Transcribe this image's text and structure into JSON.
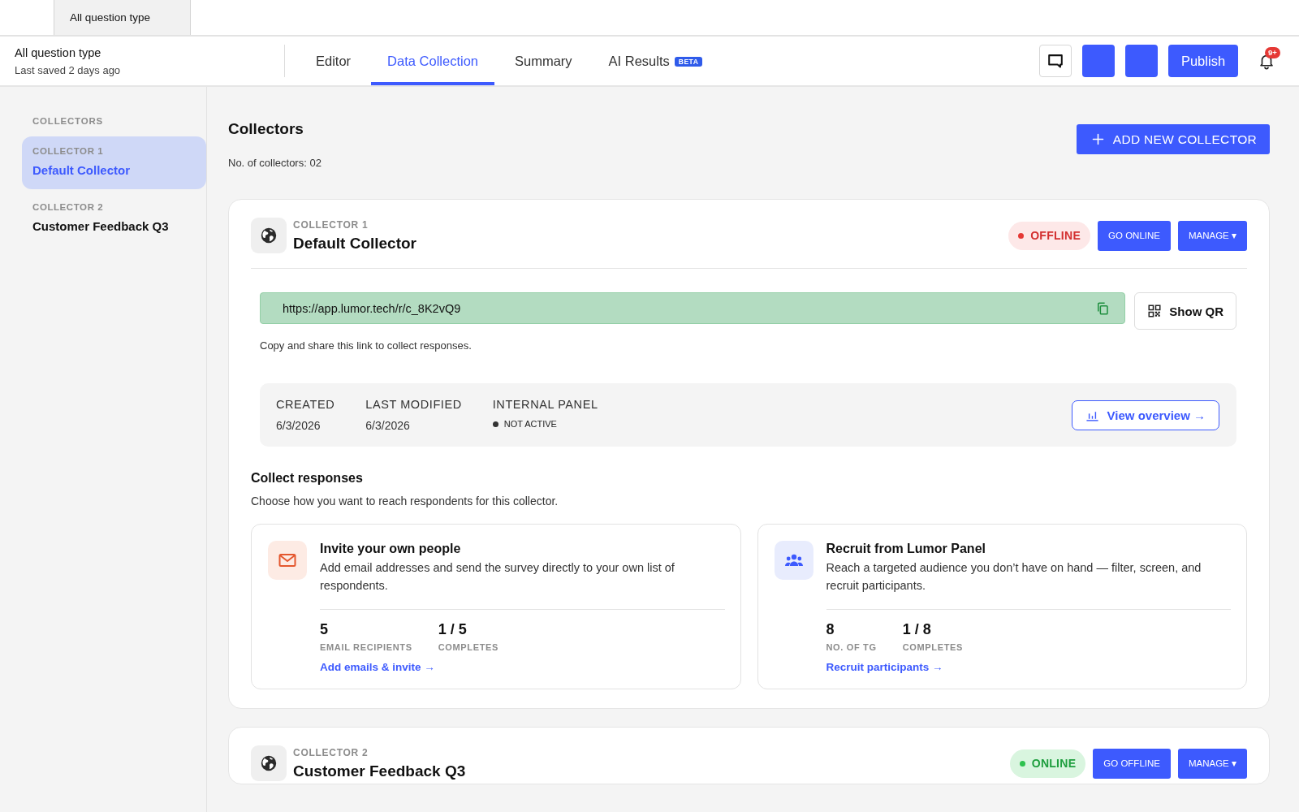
{
  "document_tab": {
    "label": "All question type"
  },
  "header": {
    "survey_title": "All question type",
    "saved_status": "Last saved 2 days ago",
    "tabs": [
      {
        "label": "Editor",
        "selected": false
      },
      {
        "label": "Data Collection",
        "selected": true
      },
      {
        "label": "Summary",
        "selected": false
      },
      {
        "label": "AI Results",
        "selected": false,
        "badge": "BETA"
      }
    ],
    "publish_button": "Publish",
    "notification_badge": "9+"
  },
  "sidebar": {
    "heading": "COLLECTORS",
    "items": [
      {
        "label": "COLLECTOR 1",
        "name": "Default Collector",
        "selected": true
      },
      {
        "label": "COLLECTOR 2",
        "name": "Customer Feedback Q3",
        "selected": false
      }
    ]
  },
  "main": {
    "title": "Collectors",
    "count": "No. of collectors: 02",
    "add_button": "ADD NEW COLLECTOR",
    "collectors": [
      {
        "label": "COLLECTOR 1",
        "name": "Default Collector",
        "online": false,
        "status_label": "OFFLINE",
        "toggle_button": "GO ONLINE",
        "manage_button": "MANAGE ▾",
        "link": {
          "url": "https://app.lumor.tech/r/c_8K2vQ9",
          "qr_button": "Show QR",
          "hint": "Copy and share this link to collect responses."
        },
        "details": {
          "fields": [
            {
              "kind": "text",
              "label": "CREATED",
              "value": "6/3/2026"
            },
            {
              "kind": "text",
              "label": "LAST MODIFIED",
              "value": "6/3/2026"
            },
            {
              "kind": "status",
              "label": "INTERNAL PANEL",
              "value": "NOT ACTIVE"
            }
          ],
          "overview_button": "View overview →"
        },
        "collect": {
          "title": "Collect responses",
          "subtitle": "Choose how you want to reach respondents for this collector.",
          "options": [
            {
              "kind": "email",
              "title": "Invite your own people",
              "description": "Add email addresses and send the survey directly to your own list of respondents.",
              "stats": [
                {
                  "value": "5",
                  "label": "EMAIL RECIPIENTS"
                },
                {
                  "value": "1 / 5",
                  "label": "COMPLETES"
                }
              ],
              "link": "Add emails & invite →"
            },
            {
              "kind": "panel",
              "title": "Recruit from Lumor Panel",
              "description": "Reach a targeted audience you don’t have on hand — filter, screen, and recruit participants.",
              "stats": [
                {
                  "value": "8",
                  "label": "NO. OF TG"
                },
                {
                  "value": "1 / 8",
                  "label": "COMPLETES"
                }
              ],
              "link": "Recruit participants →"
            }
          ]
        }
      },
      {
        "label": "COLLECTOR 2",
        "name": "Customer Feedback Q3",
        "online": true,
        "status_label": "ONLINE",
        "toggle_button": "GO OFFLINE",
        "manage_button": "MANAGE ▾"
      }
    ]
  }
}
